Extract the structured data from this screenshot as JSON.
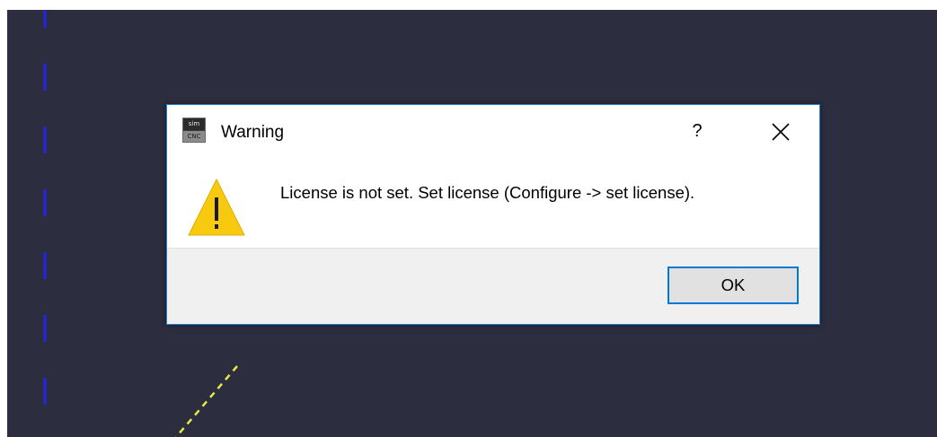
{
  "dialog": {
    "title": "Warning",
    "help_label": "?",
    "message": "License is not set. Set license (Configure -> set license).",
    "ok_label": "OK"
  },
  "app_icon": {
    "top_text": "sim",
    "bottom_text": "CNC"
  },
  "icons": {
    "app": "simcnc-app-icon",
    "warning": "warning-triangle-icon",
    "close": "close-icon"
  },
  "colors": {
    "workspace_bg": "#2d2d40",
    "dialog_border": "#1883d7",
    "warning_fill": "#f7c90f",
    "axis_blue": "#2424e6",
    "toolpath_yellow": "#e8e84a",
    "ok_button_border": "#0078d7"
  }
}
